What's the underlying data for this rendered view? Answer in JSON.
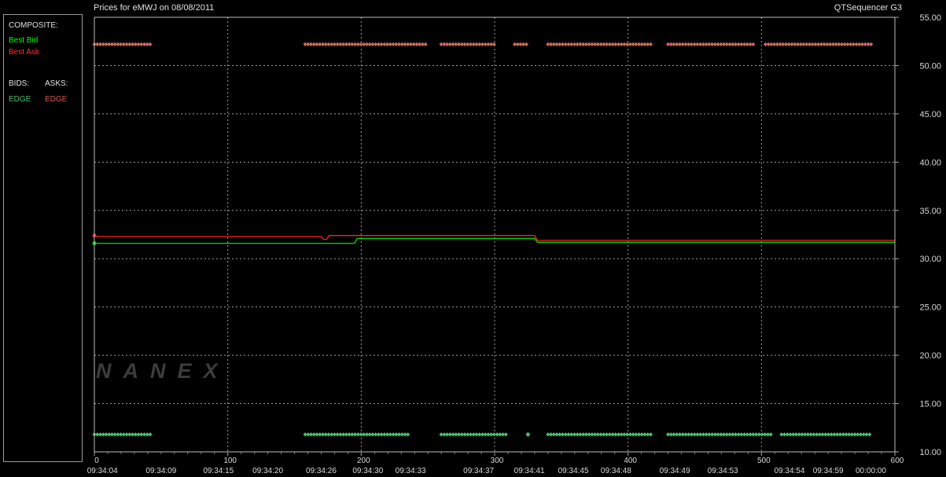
{
  "header": {
    "title": "Prices for  eMWJ  on  08/08/2011",
    "app": "QTSequencer G3"
  },
  "legend": {
    "composite_label": "COMPOSITE:",
    "best_bid": "Best Bid",
    "best_ask": "Best Ask",
    "bids_label": "BIDS:",
    "asks_label": "ASKS:",
    "bid_exchange": "EDGE",
    "ask_exchange": "EDGE"
  },
  "watermark": "NANEX",
  "colors": {
    "bid": "#00dd00",
    "ask": "#ff2020",
    "bid_dots": "#4cc070",
    "ask_dots": "#c86a5e",
    "grid": "#b8b8b8",
    "background": "#000000"
  },
  "chart_data": {
    "type": "line",
    "title": "Prices for  eMWJ  on  08/08/2011",
    "x_range": [
      0,
      600
    ],
    "ylim": [
      10,
      55
    ],
    "y_ticks": [
      "10.00",
      "15.00",
      "20.00",
      "25.00",
      "30.00",
      "35.00",
      "40.00",
      "45.00",
      "50.00",
      "55.00"
    ],
    "x_ticks": [
      "0",
      "100",
      "200",
      "300",
      "400",
      "500",
      "600"
    ],
    "time_labels": [
      {
        "x": 6,
        "label": "09:34:04"
      },
      {
        "x": 50,
        "label": "09:34:09"
      },
      {
        "x": 93,
        "label": "09:34:15"
      },
      {
        "x": 130,
        "label": "09:34:20"
      },
      {
        "x": 170,
        "label": "09:34:26"
      },
      {
        "x": 205,
        "label": "09:34:30"
      },
      {
        "x": 237,
        "label": "09:34:33"
      },
      {
        "x": 288,
        "label": "09:34:37"
      },
      {
        "x": 326,
        "label": "09:34:41"
      },
      {
        "x": 359,
        "label": "09:34:45"
      },
      {
        "x": 391,
        "label": "09:34:48"
      },
      {
        "x": 435,
        "label": "09:34:49"
      },
      {
        "x": 471,
        "label": "09:34:53"
      },
      {
        "x": 521,
        "label": "09:34:54"
      },
      {
        "x": 550,
        "label": "09:34:59"
      },
      {
        "x": 582,
        "label": "00:00:00"
      }
    ],
    "grid": true,
    "series": [
      {
        "name": "Best Bid",
        "color": "#00dd00",
        "x": [
          0,
          195,
          197,
          330,
          332,
          600
        ],
        "y": [
          31.6,
          31.6,
          32.1,
          32.1,
          31.7,
          31.7
        ]
      },
      {
        "name": "Best Ask",
        "color": "#ff2020",
        "x": [
          0,
          2,
          170,
          172,
          174,
          176,
          330,
          332,
          600
        ],
        "y": [
          32.4,
          32.3,
          32.3,
          32.0,
          32.0,
          32.4,
          32.4,
          31.9,
          31.9
        ]
      }
    ],
    "bid_quotes": {
      "name": "EDGE",
      "y": 11.8,
      "segments": [
        [
          0,
          42
        ],
        [
          158,
          235
        ],
        [
          260,
          310
        ],
        [
          325,
          325
        ],
        [
          340,
          418
        ],
        [
          430,
          508
        ],
        [
          515,
          583
        ]
      ]
    },
    "ask_quotes": {
      "name": "EDGE",
      "y": 52.2,
      "segments": [
        [
          0,
          42
        ],
        [
          158,
          250
        ],
        [
          260,
          300
        ],
        [
          315,
          325
        ],
        [
          340,
          418
        ],
        [
          430,
          495
        ],
        [
          503,
          583
        ]
      ]
    }
  }
}
